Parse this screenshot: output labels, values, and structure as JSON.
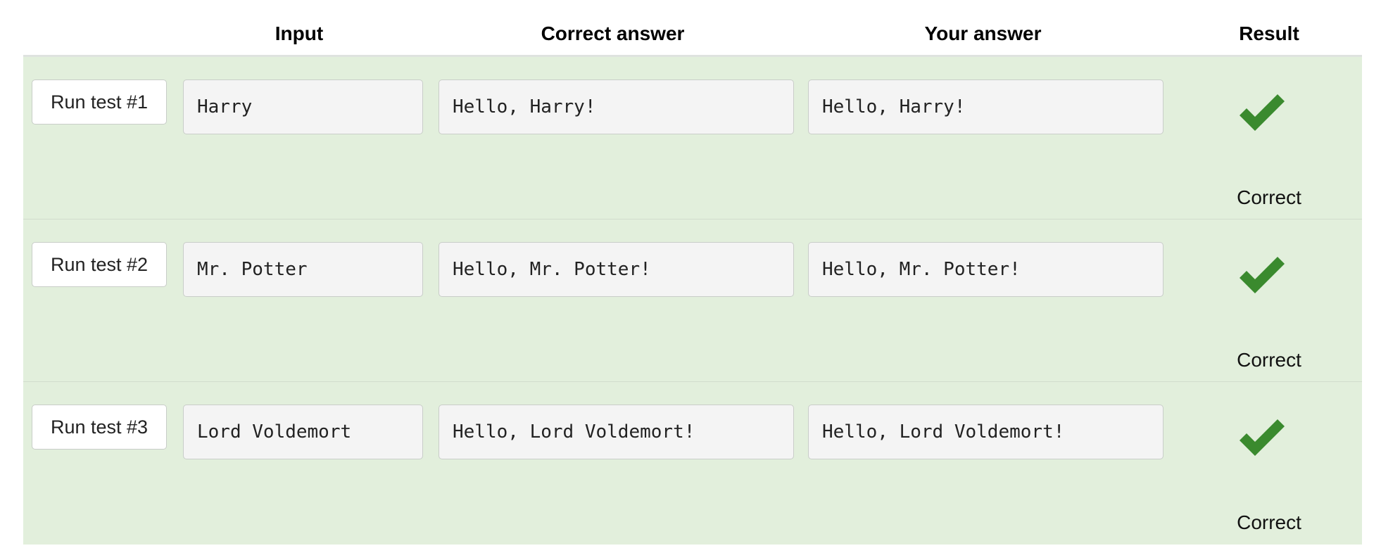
{
  "headers": {
    "input": "Input",
    "correct": "Correct answer",
    "yours": "Your answer",
    "result": "Result"
  },
  "tests": [
    {
      "run_label": "Run test #1",
      "input": "Harry",
      "correct": "Hello, Harry!",
      "yours": "Hello, Harry!",
      "result": "Correct",
      "icon": "checkmark-icon"
    },
    {
      "run_label": "Run test #2",
      "input": "Mr. Potter",
      "correct": "Hello, Mr. Potter!",
      "yours": "Hello, Mr. Potter!",
      "result": "Correct",
      "icon": "checkmark-icon"
    },
    {
      "run_label": "Run test #3",
      "input": "Lord Voldemort",
      "correct": "Hello, Lord Voldemort!",
      "yours": "Hello, Lord Voldemort!",
      "result": "Correct",
      "icon": "checkmark-icon"
    }
  ],
  "colors": {
    "row_background": "#e2efdc",
    "check_green": "#3a8a2e"
  }
}
